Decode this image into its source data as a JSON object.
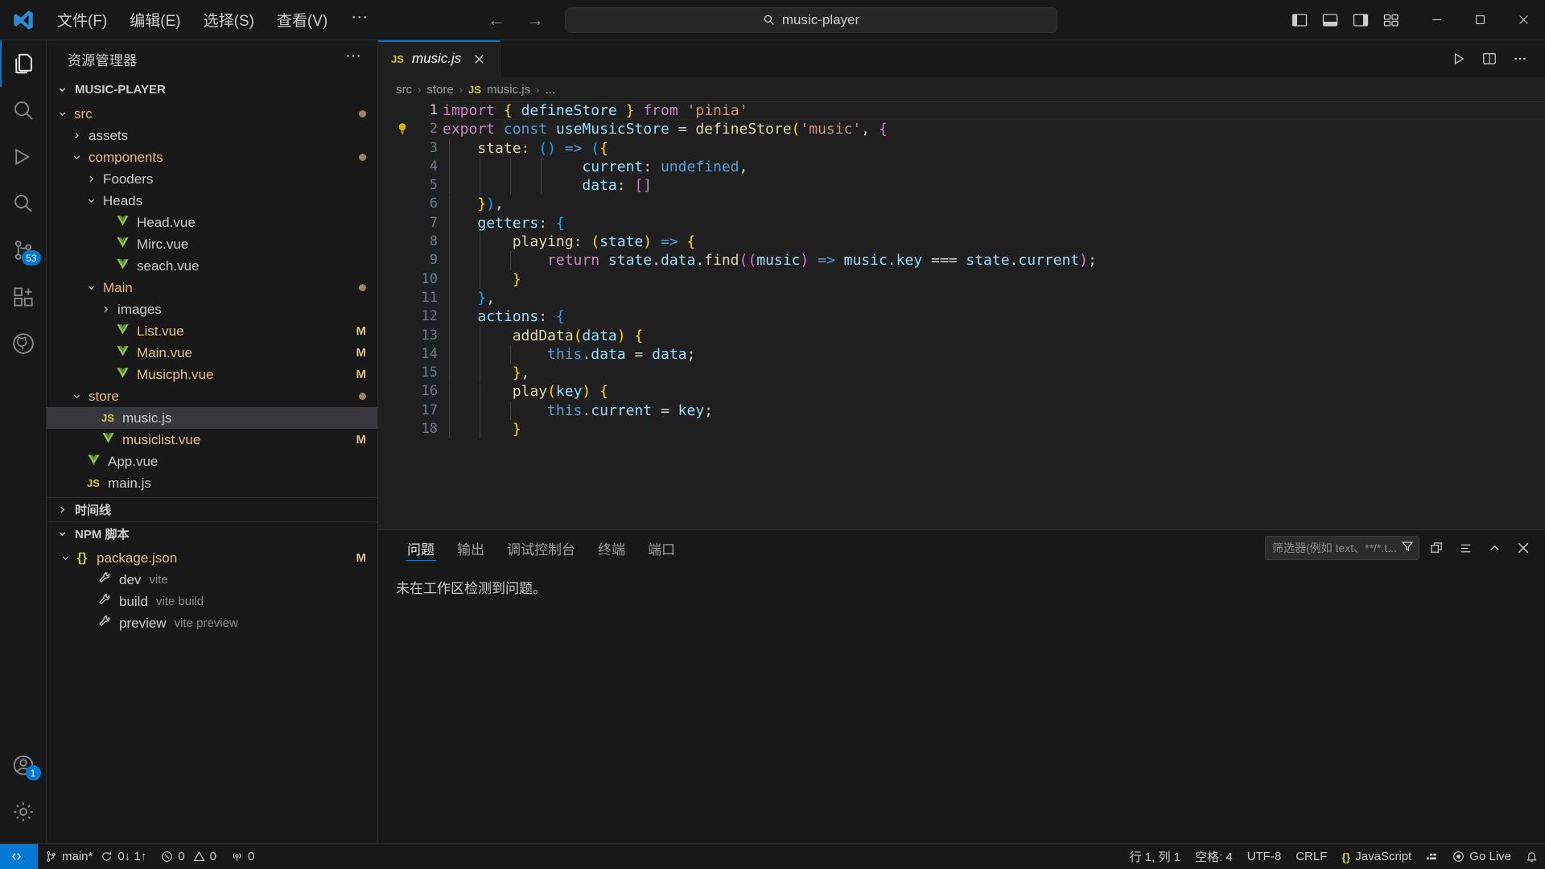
{
  "titlebar": {
    "menu": [
      "文件(F)",
      "编辑(E)",
      "选择(S)",
      "查看(V)"
    ],
    "more_label": "···",
    "back_arrow": "←",
    "forward_arrow": "→",
    "command_center_text": "music-player",
    "search_icon": "search-icon",
    "layout_buttons": [
      "toggle-primary-sidebar-icon",
      "toggle-panel-icon",
      "toggle-secondary-sidebar-icon",
      "customize-layout-icon"
    ],
    "window_controls": [
      "minimize",
      "maximize",
      "close"
    ]
  },
  "activitybar": {
    "items": [
      {
        "name": "explorer",
        "icon": "files-icon",
        "active": true,
        "badge": ""
      },
      {
        "name": "search",
        "icon": "search-icon",
        "active": false,
        "badge": ""
      },
      {
        "name": "run-and-debug-alt",
        "icon": "debug-icon",
        "active": false,
        "badge": ""
      },
      {
        "name": "search-panel",
        "icon": "magnifier-icon",
        "active": false,
        "badge": ""
      },
      {
        "name": "source-control",
        "icon": "source-control-icon",
        "active": false,
        "badge": "53"
      },
      {
        "name": "extensions",
        "icon": "extensions-icon",
        "active": false,
        "badge": ""
      },
      {
        "name": "github",
        "icon": "github-icon",
        "active": false,
        "badge": ""
      }
    ],
    "bottom": [
      {
        "name": "accounts",
        "icon": "account-icon",
        "badge": "1"
      },
      {
        "name": "manage",
        "icon": "gear-icon",
        "badge": ""
      }
    ]
  },
  "sidebar": {
    "title": "资源管理器",
    "more_actions": "···",
    "root_label": "MUSIC-PLAYER",
    "tree": [
      {
        "label": "src",
        "depth": 1,
        "type": "folder",
        "expanded": true,
        "color": "folder",
        "dot": true,
        "badge": ""
      },
      {
        "label": "assets",
        "depth": 2,
        "type": "folder",
        "expanded": false,
        "color": "plain",
        "dot": false,
        "badge": ""
      },
      {
        "label": "components",
        "depth": 2,
        "type": "folder",
        "expanded": true,
        "color": "folder",
        "dot": true,
        "badge": ""
      },
      {
        "label": "Fooders",
        "depth": 3,
        "type": "folder",
        "expanded": false,
        "color": "plain",
        "dot": false,
        "badge": ""
      },
      {
        "label": "Heads",
        "depth": 3,
        "type": "folder",
        "expanded": true,
        "color": "plain",
        "dot": false,
        "badge": ""
      },
      {
        "label": "Head.vue",
        "depth": 4,
        "type": "vue",
        "color": "plain",
        "dot": false,
        "badge": ""
      },
      {
        "label": "Mirc.vue",
        "depth": 4,
        "type": "vue",
        "color": "plain",
        "dot": false,
        "badge": ""
      },
      {
        "label": "seach.vue",
        "depth": 4,
        "type": "vue",
        "color": "plain",
        "dot": false,
        "badge": ""
      },
      {
        "label": "Main",
        "depth": 3,
        "type": "folder",
        "expanded": true,
        "color": "folder",
        "dot": true,
        "badge": ""
      },
      {
        "label": "images",
        "depth": 4,
        "type": "folder",
        "expanded": false,
        "color": "plain",
        "dot": false,
        "badge": ""
      },
      {
        "label": "List.vue",
        "depth": 4,
        "type": "vue",
        "color": "mod",
        "dot": false,
        "badge": "M"
      },
      {
        "label": "Main.vue",
        "depth": 4,
        "type": "vue",
        "color": "mod",
        "dot": false,
        "badge": "M"
      },
      {
        "label": "Musicph.vue",
        "depth": 4,
        "type": "vue",
        "color": "mod",
        "dot": false,
        "badge": "M"
      },
      {
        "label": "store",
        "depth": 2,
        "type": "folder",
        "expanded": true,
        "color": "folder",
        "dot": true,
        "badge": ""
      },
      {
        "label": "music.js",
        "depth": 3,
        "type": "js",
        "color": "plain",
        "dot": false,
        "badge": "",
        "selected": true
      },
      {
        "label": "musiclist.vue",
        "depth": 3,
        "type": "vue",
        "color": "mod",
        "dot": false,
        "badge": "M"
      },
      {
        "label": "App.vue",
        "depth": 2,
        "type": "vue",
        "color": "plain",
        "dot": false,
        "badge": ""
      },
      {
        "label": "main.js",
        "depth": 2,
        "type": "js",
        "color": "plain",
        "dot": false,
        "badge": ""
      }
    ],
    "timeline_label": "时间线",
    "npm_label": "NPM 脚本",
    "npm_tree": [
      {
        "label": "package.json",
        "sublabel": "",
        "depth": 1,
        "type": "json",
        "expanded": true,
        "badge": "M"
      },
      {
        "label": "dev",
        "sublabel": "vite",
        "depth": 2,
        "type": "script",
        "badge": ""
      },
      {
        "label": "build",
        "sublabel": "vite build",
        "depth": 2,
        "type": "script",
        "badge": ""
      },
      {
        "label": "preview",
        "sublabel": "vite preview",
        "depth": 2,
        "type": "script",
        "badge": ""
      }
    ]
  },
  "editor": {
    "tab": {
      "label": "music.js",
      "icon": "js-icon",
      "close_icon": "close-icon",
      "preview": true
    },
    "actions": [
      "run-icon",
      "split-editor-icon",
      "more-actions-icon"
    ],
    "breadcrumbs": [
      "src",
      "store",
      "music.js",
      "..."
    ],
    "breadcrumb_sep": "›",
    "lines": [
      {
        "n": 1,
        "html": "<span class='t-kw'>import</span> <span class='t-brk1'>{</span> <span class='t-var'>defineStore</span> <span class='t-brk1'>}</span> <span class='t-kw'>from</span> <span class='t-str'>'pinia'</span>"
      },
      {
        "n": 2,
        "html": "<span class='t-kw'>export</span> <span class='t-kw2'>const</span> <span class='t-var'>useMusicStore</span> <span class='t-op'>=</span> <span class='t-fn'>defineStore</span><span class='t-brk1'>(</span><span class='t-str'>'music'</span><span class='t-op'>,</span> <span class='t-brk2'>{</span>"
      },
      {
        "n": 3,
        "html": "    <span class='t-fn'>state</span><span class='t-op'>:</span> <span class='t-brk3'>()</span> <span class='t-kw2'>=&gt;</span> <span class='t-brk3'>(</span><span class='t-brk1'>{</span>"
      },
      {
        "n": 4,
        "html": "                <span class='t-prop'>current</span><span class='t-op'>:</span> <span class='t-kw2'>undefined</span><span class='t-op'>,</span>"
      },
      {
        "n": 5,
        "html": "                <span class='t-prop'>data</span><span class='t-op'>:</span> <span class='t-brk2'>[]</span>"
      },
      {
        "n": 6,
        "html": "    <span class='t-brk1'>}</span><span class='t-brk3'>)</span><span class='t-op'>,</span>"
      },
      {
        "n": 7,
        "html": "    <span class='t-var'>getters</span><span class='t-op'>:</span> <span class='t-brk3'>{</span>"
      },
      {
        "n": 8,
        "html": "        <span class='t-fn'>playing</span><span class='t-op'>:</span> <span class='t-brk1'>(</span><span class='t-var'>state</span><span class='t-brk1'>)</span> <span class='t-kw2'>=&gt;</span> <span class='t-brk1'>{</span>"
      },
      {
        "n": 9,
        "html": "            <span class='t-kw'>return</span> <span class='t-var'>state</span><span class='t-op'>.</span><span class='t-prop'>data</span><span class='t-op'>.</span><span class='t-fn'>find</span><span class='t-brk2'>((</span><span class='t-var'>music</span><span class='t-brk2'>)</span> <span class='t-kw2'>=&gt;</span> <span class='t-var'>music</span><span class='t-op'>.</span><span class='t-prop'>key</span> <span class='t-op'>===</span> <span class='t-var'>state</span><span class='t-op'>.</span><span class='t-prop'>current</span><span class='t-brk2'>)</span><span class='t-op'>;</span>"
      },
      {
        "n": 10,
        "html": "        <span class='t-brk1'>}</span>"
      },
      {
        "n": 11,
        "html": "    <span class='t-brk3'>}</span><span class='t-op'>,</span>"
      },
      {
        "n": 12,
        "html": "    <span class='t-var'>actions</span><span class='t-op'>:</span> <span class='t-brk3'>{</span>"
      },
      {
        "n": 13,
        "html": "        <span class='t-fn'>addData</span><span class='t-brk1'>(</span><span class='t-var'>data</span><span class='t-brk1'>)</span> <span class='t-brk1'>{</span>"
      },
      {
        "n": 14,
        "html": "            <span class='t-kw2'>this</span><span class='t-op'>.</span><span class='t-prop'>data</span> <span class='t-op'>=</span> <span class='t-var'>data</span><span class='t-op'>;</span>"
      },
      {
        "n": 15,
        "html": "        <span class='t-brk1'>}</span><span class='t-op'>,</span>"
      },
      {
        "n": 16,
        "html": "        <span class='t-fn'>play</span><span class='t-brk1'>(</span><span class='t-var'>key</span><span class='t-brk1'>)</span> <span class='t-brk1'>{</span>"
      },
      {
        "n": 17,
        "html": "            <span class='t-kw2'>this</span><span class='t-op'>.</span><span class='t-prop'>current</span> <span class='t-op'>=</span> <span class='t-var'>key</span><span class='t-op'>;</span>"
      },
      {
        "n": 18,
        "html": "        <span class='t-brk1'>}</span>"
      }
    ],
    "current_line": 1,
    "lightbulb_line": 2
  },
  "panel": {
    "tabs": [
      "问题",
      "输出",
      "调试控制台",
      "终端",
      "端口"
    ],
    "active_tab": "问题",
    "filter_placeholder": "筛选器(例如 text、**/*.t...",
    "filter_icon": "filter-icon",
    "actions": [
      "clear-icon",
      "view-as-table-icon",
      "collapse-icon",
      "close-panel-icon"
    ],
    "message": "未在工作区检测到问题。"
  },
  "statusbar": {
    "remote_label": "",
    "remote_icon": "remote-window-icon",
    "branch": "main*",
    "sync": "0↓ 1↑",
    "errors": "0",
    "warnings": "0",
    "ports": "0",
    "cursor_position": "行 1, 列 1",
    "indentation": "空格: 4",
    "encoding": "UTF-8",
    "eol": "CRLF",
    "language": "JavaScript",
    "prettier_icon": "prettier-icon",
    "go_live": "Go Live",
    "notifications_icon": "bell-icon"
  },
  "colors": {
    "accent": "#0078d4",
    "modified": "#e2c08d",
    "folder": "#e4b781",
    "vue_green": "#8dc149",
    "js_yellow": "#cbcb41",
    "bg": "#1f1f1f",
    "chrome": "#181818"
  }
}
